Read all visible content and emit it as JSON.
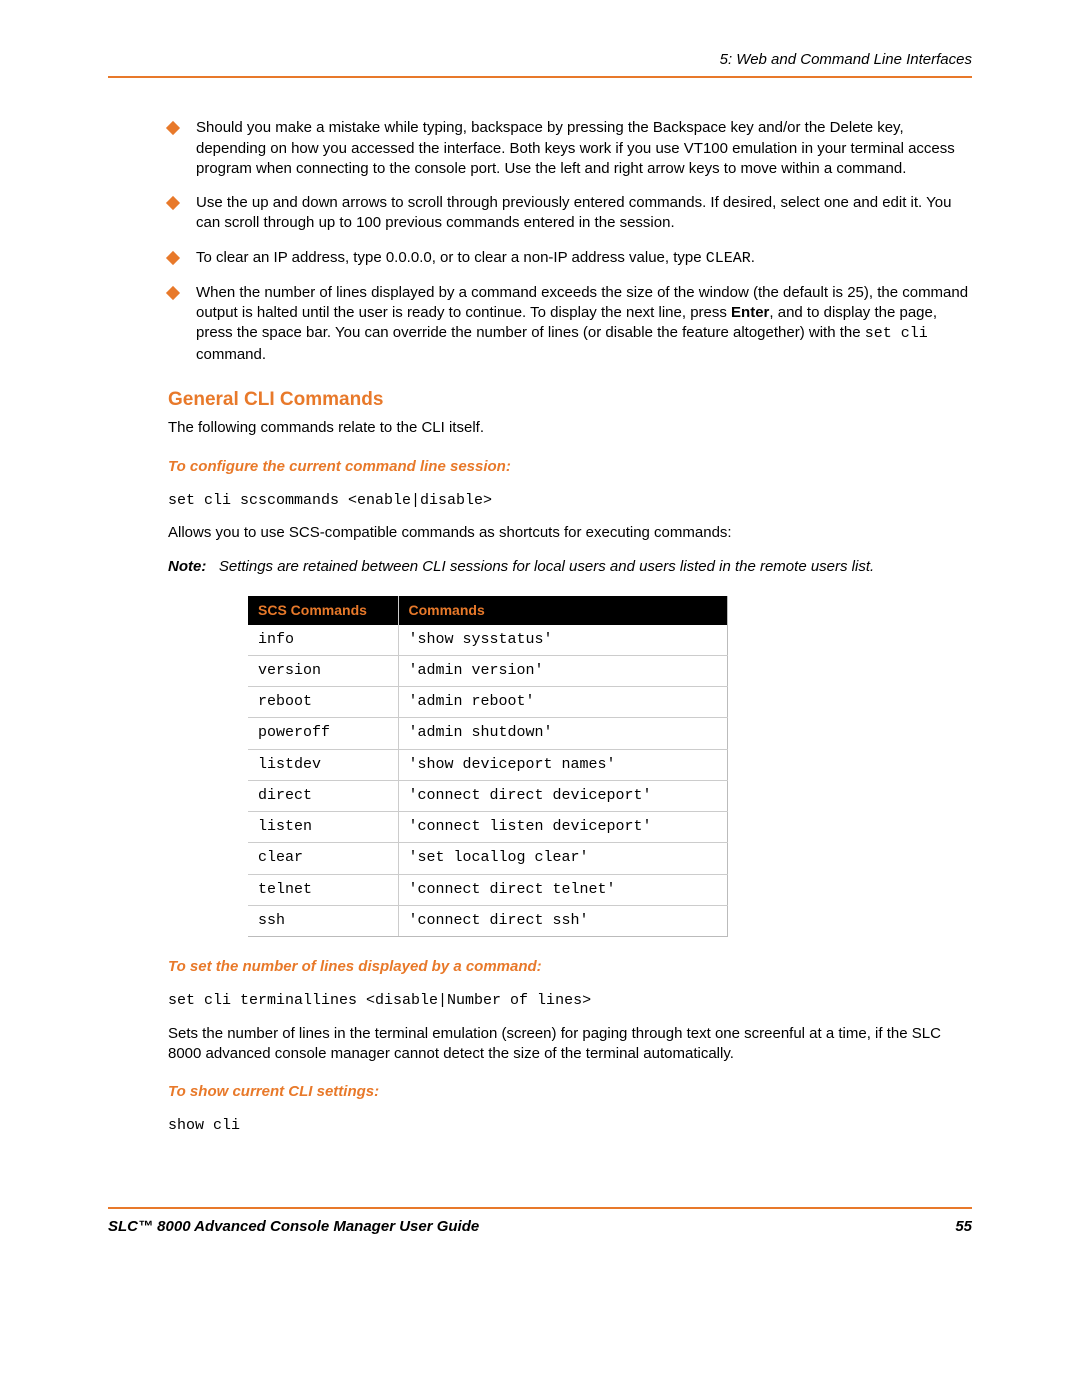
{
  "header": {
    "chapter": "5: Web and Command Line Interfaces"
  },
  "bullets": [
    {
      "pre": "Should you make a mistake while typing, backspace by pressing the Backspace key and/or the Delete key, depending on how you accessed the interface. Both keys work if you use VT100 emulation in your terminal access program when connecting to the console port. Use the left and right arrow keys to move within a command."
    },
    {
      "pre": "Use the up and down arrows to scroll through previously entered commands. If desired, select one and edit it. You can scroll through up to 100 previous commands entered in the session."
    },
    {
      "pre": "To clear an IP address, type 0.0.0.0, or to clear a non-IP address value, type ",
      "code": "CLEAR",
      "post": "."
    },
    {
      "pre": "When the number of lines displayed by a command exceeds the size of the window (the default is 25), the command output is halted until the user is ready to continue. To display the next line, press ",
      "bold": "Enter",
      "mid": ", and to display the page, press the space bar. You can override the number of lines (or disable the feature altogether) with the ",
      "code": "set cli",
      "post": " command."
    }
  ],
  "section": {
    "heading": "General CLI Commands",
    "intro": "The following commands relate to the CLI itself."
  },
  "sub1": {
    "heading": "To configure the current command line session:",
    "code": "set cli scscommands <enable|disable>",
    "desc": "Allows you to use SCS-compatible commands as shortcuts for executing commands:"
  },
  "note": {
    "label": "Note:",
    "text": "Settings are retained between CLI sessions for local users and users listed in the remote users list."
  },
  "table": {
    "headers": {
      "col1": "SCS Commands",
      "col2": "Commands"
    },
    "rows": [
      {
        "scs": "info",
        "cmd": "'show sysstatus'"
      },
      {
        "scs": "version",
        "cmd": "'admin version'"
      },
      {
        "scs": "reboot",
        "cmd": "'admin reboot'"
      },
      {
        "scs": "poweroff",
        "cmd": "'admin shutdown'"
      },
      {
        "scs": "listdev",
        "cmd": "'show deviceport names'"
      },
      {
        "scs": "direct",
        "cmd": "'connect direct deviceport'"
      },
      {
        "scs": "listen",
        "cmd": "'connect listen deviceport'"
      },
      {
        "scs": "clear",
        "cmd": "'set locallog clear'"
      },
      {
        "scs": "telnet",
        "cmd": "'connect direct telnet'"
      },
      {
        "scs": "ssh",
        "cmd": "'connect direct ssh'"
      }
    ]
  },
  "sub2": {
    "heading": "To set the number of lines displayed by a command:",
    "code": "set cli terminallines <disable|Number of lines>",
    "desc": "Sets the number of lines in the terminal emulation (screen) for paging through text one screenful at a time, if the SLC 8000 advanced console manager cannot detect the size of the terminal automatically."
  },
  "sub3": {
    "heading": "To show current CLI settings:",
    "code": "show cli"
  },
  "footer": {
    "title": "SLC™ 8000 Advanced Console Manager User Guide",
    "page": "55"
  }
}
